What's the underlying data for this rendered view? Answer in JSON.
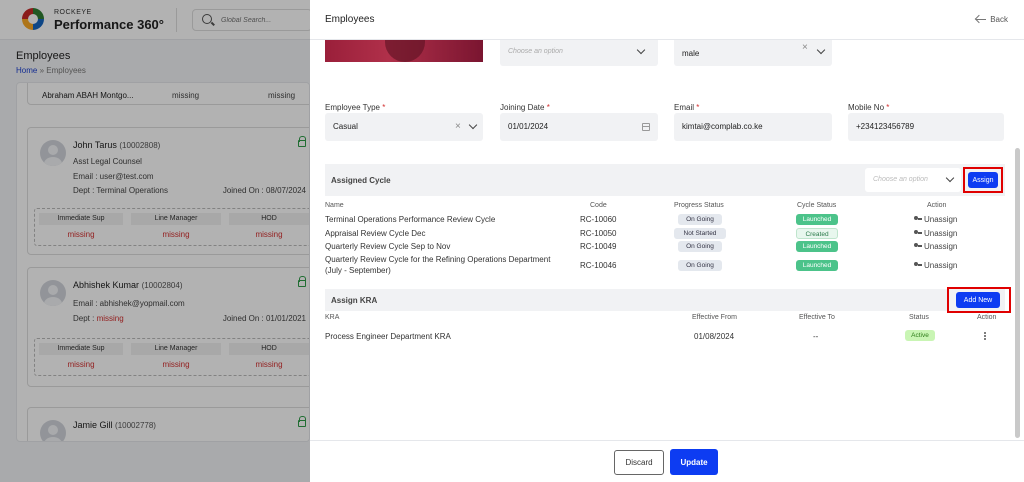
{
  "brand": {
    "small": "ROCKEYE",
    "big": "Performance 360°"
  },
  "search": {
    "placeholder": "Global Search..."
  },
  "page": {
    "title": "Employees",
    "breadcrumb_home": "Home",
    "breadcrumb_sep": "»",
    "breadcrumb_current": "Employees"
  },
  "list": {
    "top_row": {
      "name": "Abraham ABAH Montgo...",
      "val1": "missing",
      "val2": "missing"
    },
    "cards": [
      {
        "name": "John Tarus",
        "code": "(10002808)",
        "title": "Asst Legal Counsel",
        "email": "Email : user@test.com",
        "dept_label": "Dept :",
        "dept": "Terminal Operations",
        "joined": "Joined On : 08/07/2024",
        "sup_heads": [
          "Immediate Sup",
          "Line Manager",
          "HOD"
        ],
        "sup_vals": [
          "missing",
          "missing",
          "missing"
        ]
      },
      {
        "name": "Abhishek Kumar",
        "code": "(10002804)",
        "email": "Email : abhishek@yopmail.com",
        "dept_label": "Dept :",
        "dept": "missing",
        "joined": "Joined On : 01/01/2021",
        "sup_heads": [
          "Immediate Sup",
          "Line Manager",
          "HOD"
        ],
        "sup_vals": [
          "missing",
          "missing",
          "missing"
        ]
      },
      {
        "name": "Jamie Gill",
        "code": "(10002778)"
      }
    ]
  },
  "drawer": {
    "title": "Employees",
    "back_label": "Back",
    "form": {
      "row0": {
        "select_placeholder": "Choose an option",
        "gender_value": "male"
      },
      "employee_type": {
        "label": "Employee Type",
        "value": "Casual"
      },
      "joining_date": {
        "label": "Joining Date",
        "value": "01/01/2024"
      },
      "email": {
        "label": "Email",
        "value": "kimtai@complab.co.ke"
      },
      "mobile": {
        "label": "Mobile No",
        "value": "+234123456789"
      },
      "required_mark": "*"
    },
    "assigned_cycle": {
      "title": "Assigned Cycle",
      "select_placeholder": "Choose an option",
      "assign_label": "Assign",
      "headers": [
        "Name",
        "Code",
        "Progress Status",
        "Cycle Status",
        "Action"
      ],
      "rows": [
        {
          "name": "Terminal Operations Performance Review Cycle",
          "code": "RC-10060",
          "progress": "On Going",
          "cycle": "Launched",
          "action": "Unassign"
        },
        {
          "name": "Appraisal Review Cycle Dec",
          "code": "RC-10050",
          "progress": "Not Started",
          "cycle": "Created",
          "action": "Unassign"
        },
        {
          "name": "Quarterly Review Cycle Sep to Nov",
          "code": "RC-10049",
          "progress": "On Going",
          "cycle": "Launched",
          "action": "Unassign"
        },
        {
          "name": "Quarterly Review Cycle for the Refining Operations Department",
          "name2": "(July - September)",
          "code": "RC-10046",
          "progress": "On Going",
          "cycle": "Launched",
          "action": "Unassign"
        }
      ]
    },
    "assign_kra": {
      "title": "Assign KRA",
      "add_label": "Add New",
      "headers": [
        "KRA",
        "Effective From",
        "Effective To",
        "Status",
        "Action"
      ],
      "rows": [
        {
          "kra": "Process Engineer Department KRA",
          "from": "01/08/2024",
          "to": "--",
          "status": "Active"
        }
      ]
    },
    "footer": {
      "discard": "Discard",
      "update": "Update"
    }
  },
  "colors": {
    "primary": "#0d3cf2",
    "missing": "#d32f2f",
    "highlight": "#e00000"
  }
}
